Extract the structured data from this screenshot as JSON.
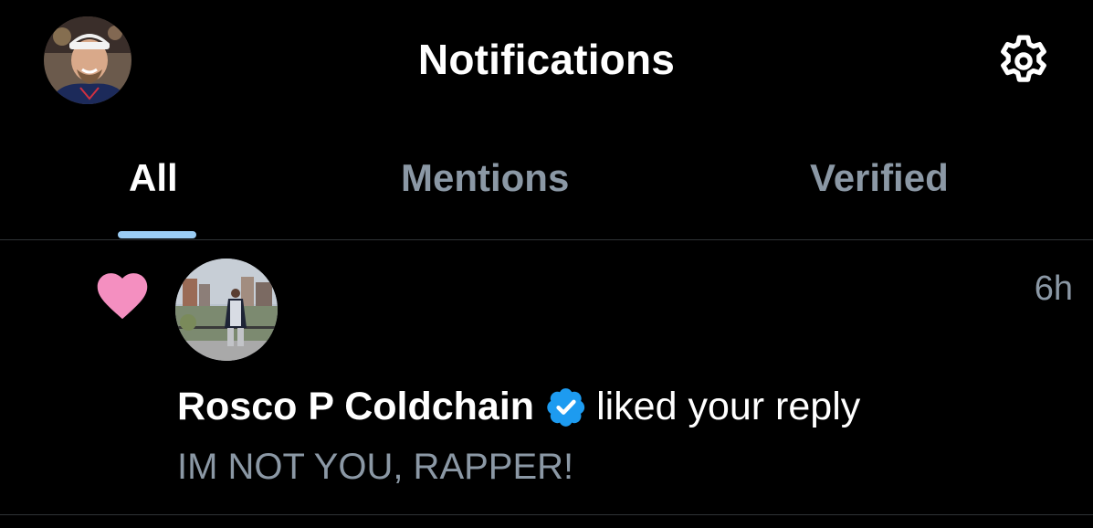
{
  "header": {
    "title": "Notifications",
    "avatar_icon": "profile-avatar-icon",
    "settings_icon": "gear-icon"
  },
  "tabs": [
    {
      "label": "All",
      "active": true
    },
    {
      "label": "Mentions",
      "active": false
    },
    {
      "label": "Verified",
      "active": false
    }
  ],
  "notifications": [
    {
      "type_icon": "heart-icon",
      "actor_name": "Rosco P Coldchain",
      "verified": true,
      "action": "liked your reply",
      "snippet": "IM NOT YOU, RAPPER!",
      "time": "6h"
    }
  ],
  "colors": {
    "background": "#000000",
    "tab_indicator": "#9bcdf5",
    "like_heart": "#f48fc0",
    "verified_badge": "#1d9bf0",
    "secondary_text": "#8b98a5"
  }
}
